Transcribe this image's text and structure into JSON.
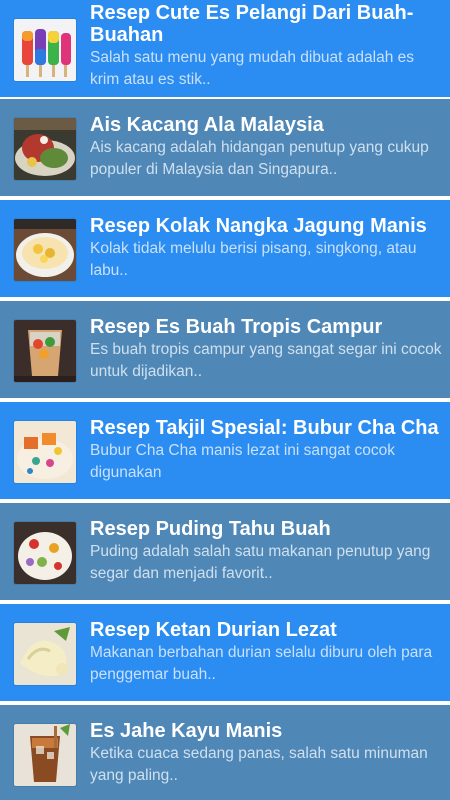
{
  "recipes": [
    {
      "title": "Resep Cute Es Pelangi Dari Buah-Buahan",
      "description": "Salah satu menu yang mudah dibuat adalah es krim atau es stik..",
      "thumbnail": "rainbow-popsicle-image"
    },
    {
      "title": "Ais Kacang Ala Malaysia",
      "description": "Ais kacang adalah hidangan penutup yang cukup populer di Malaysia dan Singapura..",
      "thumbnail": "ais-kacang-image"
    },
    {
      "title": "Resep Kolak Nangka Jagung Manis",
      "description": "Kolak tidak melulu berisi pisang, singkong, atau labu..",
      "thumbnail": "kolak-bowl-image"
    },
    {
      "title": "Resep Es Buah Tropis Campur",
      "description": "Es buah tropis campur yang sangat segar ini cocok untuk dijadikan..",
      "thumbnail": "es-buah-glass-image"
    },
    {
      "title": "Resep Takjil Spesial: Bubur Cha Cha",
      "description": "Bubur Cha Cha manis lezat ini sangat cocok digunakan",
      "thumbnail": "bubur-cha-cha-image"
    },
    {
      "title": "Resep Puding Tahu Buah",
      "description": "Puding adalah salah satu makanan penutup yang segar dan menjadi favorit..",
      "thumbnail": "puding-tahu-image"
    },
    {
      "title": "Resep Ketan Durian Lezat",
      "description": "Makanan berbahan durian selalu diburu oleh para penggemar buah..",
      "thumbnail": "ketan-durian-image"
    },
    {
      "title": "Es Jahe Kayu Manis",
      "description": "Ketika cuaca sedang panas, salah satu minuman yang paling..",
      "thumbnail": "es-jahe-image"
    }
  ],
  "colors": {
    "row_blue": "#2b8cf2",
    "row_steel": "#4f87b7",
    "title": "#ffffff",
    "description": "#c9e1fb"
  }
}
